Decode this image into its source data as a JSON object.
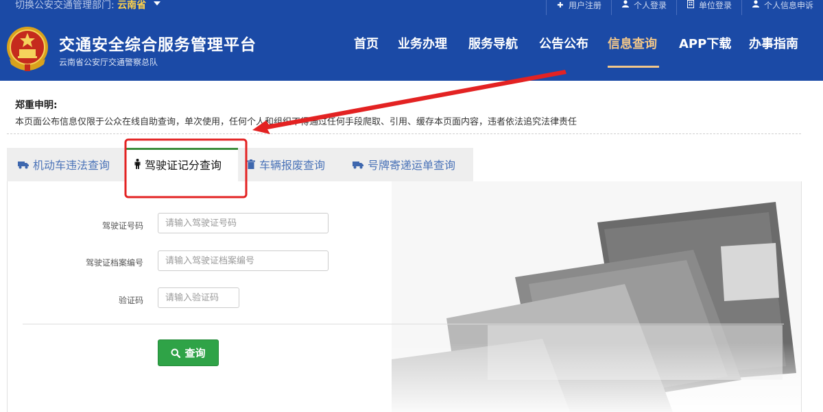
{
  "topbar": {
    "switch_label": "切换公安交通管理部门:",
    "province": "云南省",
    "links": [
      {
        "icon": "plus-icon",
        "label": "用户注册"
      },
      {
        "icon": "user-icon",
        "label": "个人登录"
      },
      {
        "icon": "building-icon",
        "label": "单位登录"
      },
      {
        "icon": "user-icon",
        "label": "个人信息申诉"
      }
    ]
  },
  "header": {
    "title": "交通安全综合服务管理平台",
    "subtitle": "云南省公安厅交通警察总队",
    "nav": [
      {
        "label": "首页"
      },
      {
        "label": "业务办理"
      },
      {
        "label": "服务导航"
      },
      {
        "label": "公告公布"
      },
      {
        "label": "信息查询",
        "active": true
      },
      {
        "label": "APP下载"
      },
      {
        "label": "办事指南"
      }
    ]
  },
  "statement": {
    "title": "郑重申明:",
    "text": "本页面公布信息仅限于公众在线自助查询，单次使用，任何个人和组织不得通过任何手段爬取、引用、缓存本页面内容，违者依法追究法律责任"
  },
  "tabs": [
    {
      "icon": "truck-icon",
      "label": "机动车违法查询"
    },
    {
      "icon": "person-icon",
      "label": "驾驶证记分查询",
      "active": true
    },
    {
      "icon": "trash-icon",
      "label": "车辆报废查询"
    },
    {
      "icon": "truck-icon",
      "label": "号牌寄递运单查询"
    }
  ],
  "form": {
    "license_no": {
      "label": "驾驶证号码",
      "placeholder": "请输入驾驶证号码",
      "value": ""
    },
    "file_no": {
      "label": "驾驶证档案编号",
      "placeholder": "请输入驾驶证档案编号",
      "value": ""
    },
    "captcha": {
      "label": "验证码",
      "placeholder": "请输入验证码",
      "value": ""
    },
    "submit_label": "查询"
  },
  "colors": {
    "brand_blue": "#1b4aa6",
    "nav_active": "#f2c78a",
    "tab_active_border": "#3c8d3c",
    "button_green": "#2fa347",
    "annotation_red": "#e32222"
  }
}
